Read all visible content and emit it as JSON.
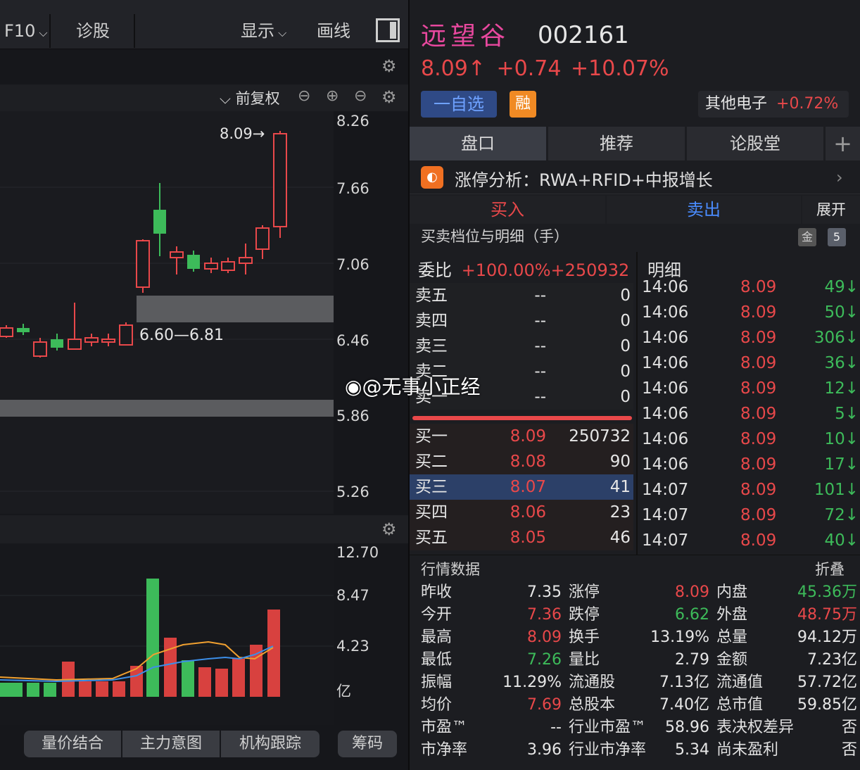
{
  "toolbar": {
    "f10": "F10",
    "diagnose": "诊股",
    "display": "显示",
    "draw": "画线"
  },
  "kline": {
    "adjust": "前复权",
    "last_price_marker": "8.09",
    "gap_label": "6.60—6.81",
    "price_axis": [
      "8.26",
      "7.66",
      "7.06",
      "6.46",
      "5.86",
      "5.26"
    ],
    "volume_axis": [
      "12.70",
      "8.47",
      "4.23",
      "亿"
    ]
  },
  "bottom_tabs": [
    "量价结合",
    "主力意图",
    "机构跟踪",
    "筹码"
  ],
  "stock": {
    "name": "远望谷",
    "code": "002161",
    "price": "8.09",
    "arrow": "↑",
    "change": "+0.74",
    "change_pct": "+10.07%",
    "watch_label": "一自选",
    "margin_label": "融",
    "sector": "其他电子",
    "sector_change": "+0.72%"
  },
  "tabs": [
    "盘口",
    "推荐",
    "论股堂",
    "+"
  ],
  "limit_analysis": {
    "label": "涨停分析：",
    "reason": "RWA+RFID+中报增长"
  },
  "trade_buttons": {
    "buy": "买入",
    "sell": "卖出",
    "expand": "展开"
  },
  "depth": {
    "title": "买卖档位与明细（手）",
    "gold": "金",
    "five": "5",
    "ratio_label": "委比",
    "ratio_value": "+100.00%",
    "ratio_diff": "+250932",
    "sell": [
      {
        "label": "卖五",
        "price": "--",
        "vol": "0"
      },
      {
        "label": "卖四",
        "price": "--",
        "vol": "0"
      },
      {
        "label": "卖三",
        "price": "--",
        "vol": "0"
      },
      {
        "label": "卖二",
        "price": "--",
        "vol": "0"
      },
      {
        "label": "卖一",
        "price": "--",
        "vol": "0"
      }
    ],
    "buy": [
      {
        "label": "买一",
        "price": "8.09",
        "vol": "250732"
      },
      {
        "label": "买二",
        "price": "8.08",
        "vol": "90"
      },
      {
        "label": "买三",
        "price": "8.07",
        "vol": "41"
      },
      {
        "label": "买四",
        "price": "8.06",
        "vol": "23"
      },
      {
        "label": "买五",
        "price": "8.05",
        "vol": "46"
      }
    ]
  },
  "detail": {
    "title": "明细",
    "rows": [
      {
        "time": "14:06",
        "price": "8.09",
        "vol": "49↓"
      },
      {
        "time": "14:06",
        "price": "8.09",
        "vol": "50↓"
      },
      {
        "time": "14:06",
        "price": "8.09",
        "vol": "306↓"
      },
      {
        "time": "14:06",
        "price": "8.09",
        "vol": "36↓"
      },
      {
        "time": "14:06",
        "price": "8.09",
        "vol": "12↓"
      },
      {
        "time": "14:06",
        "price": "8.09",
        "vol": "5↓"
      },
      {
        "time": "14:06",
        "price": "8.09",
        "vol": "10↓"
      },
      {
        "time": "14:06",
        "price": "8.09",
        "vol": "17↓"
      },
      {
        "time": "14:07",
        "price": "8.09",
        "vol": "101↓"
      },
      {
        "time": "14:07",
        "price": "8.09",
        "vol": "72↓"
      },
      {
        "time": "14:07",
        "price": "8.09",
        "vol": "40↓"
      }
    ]
  },
  "quote": {
    "title": "行情数据",
    "fold": "折叠",
    "rows": [
      [
        {
          "l": "昨收",
          "v": "7.35",
          "c": "white"
        },
        {
          "l": "涨停",
          "v": "8.09",
          "c": "red"
        },
        {
          "l": "内盘",
          "v": "45.36万",
          "c": "green"
        }
      ],
      [
        {
          "l": "今开",
          "v": "7.36",
          "c": "red"
        },
        {
          "l": "跌停",
          "v": "6.62",
          "c": "green"
        },
        {
          "l": "外盘",
          "v": "48.75万",
          "c": "red"
        }
      ],
      [
        {
          "l": "最高",
          "v": "8.09",
          "c": "red"
        },
        {
          "l": "换手",
          "v": "13.19%",
          "c": "white"
        },
        {
          "l": "总量",
          "v": "94.12万",
          "c": "white"
        }
      ],
      [
        {
          "l": "最低",
          "v": "7.26",
          "c": "green"
        },
        {
          "l": "量比",
          "v": "2.79",
          "c": "white"
        },
        {
          "l": "金额",
          "v": "7.23亿",
          "c": "white"
        }
      ],
      [
        {
          "l": "振幅",
          "v": "11.29%",
          "c": "white"
        },
        {
          "l": "流通股",
          "v": "7.13亿",
          "c": "white"
        },
        {
          "l": "流通值",
          "v": "57.72亿",
          "c": "white"
        }
      ],
      [
        {
          "l": "均价",
          "v": "7.69",
          "c": "red"
        },
        {
          "l": "总股本",
          "v": "7.40亿",
          "c": "white"
        },
        {
          "l": "总市值",
          "v": "59.85亿",
          "c": "white"
        }
      ],
      [
        {
          "l": "市盈™",
          "v": "--",
          "c": "white"
        },
        {
          "l": "行业市盈™",
          "v": "58.96",
          "c": "white"
        },
        {
          "l": "表决权差异",
          "v": "否",
          "c": "white"
        }
      ],
      [
        {
          "l": "市净率",
          "v": "3.96",
          "c": "white"
        },
        {
          "l": "行业市净率",
          "v": "5.34",
          "c": "white"
        },
        {
          "l": "尚未盈利",
          "v": "否",
          "c": "white"
        }
      ]
    ]
  },
  "watermark": "@无事小正经",
  "colors": {
    "up": "#e8484a",
    "down": "#3dbb5a",
    "name": "#e8489e",
    "accent": "#2f4a86"
  }
}
